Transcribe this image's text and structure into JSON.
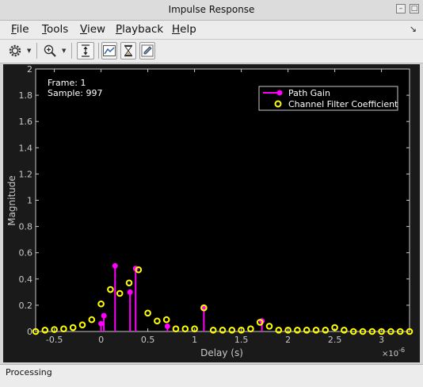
{
  "window": {
    "title": "Impulse Response"
  },
  "menu": [
    {
      "key": "F",
      "rest": "ile"
    },
    {
      "key": "T",
      "rest": "ools"
    },
    {
      "key": "V",
      "rest": "iew"
    },
    {
      "key": "P",
      "rest": "layback"
    },
    {
      "key": "H",
      "rest": "elp"
    }
  ],
  "toolbar": {
    "icons": [
      "settings-icon",
      "zoom-in-icon",
      "scale-axes-icon",
      "stem-plot-icon",
      "hourglass-icon",
      "edit-icon"
    ]
  },
  "plot": {
    "info": {
      "frame": "Frame: 1",
      "sample": "Sample: 997"
    },
    "exponent_label": "×10",
    "exponent_sup": "-6"
  },
  "status": {
    "text": "Processing"
  },
  "colors": {
    "background": "#000000",
    "figure": "#1a1a1a",
    "axis": "#c8c8c8",
    "path_gain": "#ff00ff",
    "filter_coeff": "#ffff00"
  },
  "chart_data": {
    "type": "scatter",
    "xlabel": "Delay (s)",
    "ylabel": "Magnitude",
    "x_unit_multiplier": 1e-06,
    "xlim": [
      -0.7,
      3.3
    ],
    "ylim": [
      0,
      2
    ],
    "x_ticks": [
      -0.5,
      0,
      0.5,
      1,
      1.5,
      2,
      2.5,
      3
    ],
    "x_tick_labels": [
      "-0.5",
      "0",
      "0.5",
      "1",
      "1.5",
      "2",
      "2.5",
      "3"
    ],
    "y_ticks": [
      0,
      0.2,
      0.4,
      0.6,
      0.8,
      1,
      1.2,
      1.4,
      1.6,
      1.8,
      2
    ],
    "y_tick_labels": [
      "0",
      "0.2",
      "0.4",
      "0.6",
      "0.8",
      "1",
      "1.2",
      "1.4",
      "1.6",
      "1.8",
      "2"
    ],
    "grid": false,
    "legend_position": "top-right",
    "series": [
      {
        "name": "Path Gain",
        "style": "stem",
        "color": "#ff00ff",
        "x": [
          0.0,
          0.03,
          0.15,
          0.31,
          0.37,
          0.71,
          1.1,
          1.72
        ],
        "y": [
          0.06,
          0.12,
          0.5,
          0.3,
          0.48,
          0.04,
          0.18,
          0.08
        ]
      },
      {
        "name": "Channel Filter Coefficient",
        "style": "marker",
        "color": "#ffff00",
        "x": [
          -0.7,
          -0.6,
          -0.5,
          -0.4,
          -0.3,
          -0.2,
          -0.1,
          0.0,
          0.1,
          0.2,
          0.3,
          0.4,
          0.5,
          0.6,
          0.7,
          0.8,
          0.9,
          1.0,
          1.1,
          1.2,
          1.3,
          1.4,
          1.5,
          1.6,
          1.7,
          1.8,
          1.9,
          2.0,
          2.1,
          2.2,
          2.3,
          2.4,
          2.5,
          2.6,
          2.7,
          2.8,
          2.9,
          3.0,
          3.1,
          3.2,
          3.3
        ],
        "y": [
          0.0,
          0.01,
          0.015,
          0.02,
          0.03,
          0.05,
          0.09,
          0.21,
          0.32,
          0.29,
          0.37,
          0.47,
          0.14,
          0.08,
          0.09,
          0.02,
          0.02,
          0.02,
          0.18,
          0.01,
          0.01,
          0.01,
          0.01,
          0.02,
          0.07,
          0.04,
          0.01,
          0.01,
          0.01,
          0.01,
          0.01,
          0.01,
          0.03,
          0.01,
          0.0,
          0.0,
          0.0,
          0.0,
          0.0,
          0.0,
          0.0
        ]
      }
    ]
  }
}
